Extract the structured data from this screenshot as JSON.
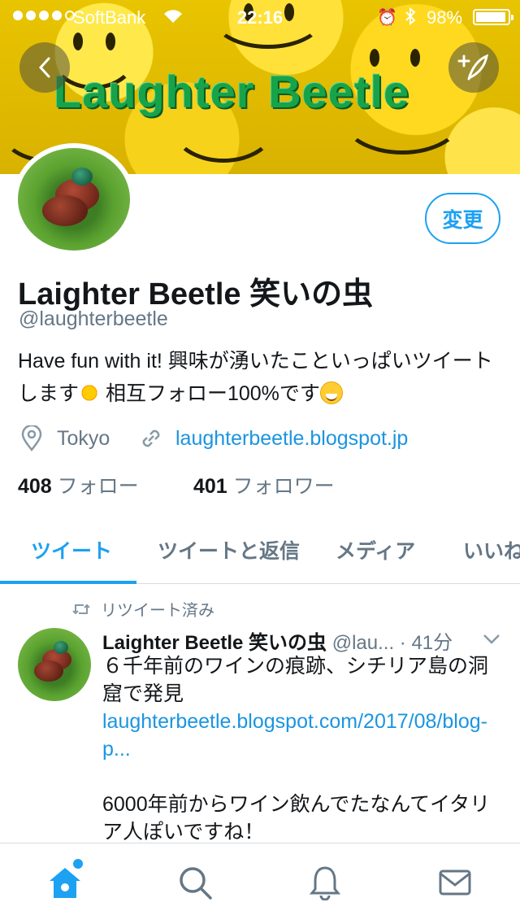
{
  "status_bar": {
    "carrier": "SoftBank",
    "time": "22:16",
    "battery": "98%"
  },
  "header": {
    "banner_text": "Laughter Beetle"
  },
  "profile": {
    "name": "Laighter Beetle 笑いの虫",
    "handle": "@laughterbeetle",
    "bio_part1": "Have fun with it! 興味が湧いたこといっぱいツイートします",
    "bio_part2": " 相互フォロー100%です",
    "location": "Tokyo",
    "website": "laughterbeetle.blogspot.jp",
    "following_count": "408",
    "following_label": "フォロー",
    "followers_count": "401",
    "followers_label": "フォロワー",
    "edit_label": "変更"
  },
  "tabs": [
    {
      "label": "ツイート",
      "active": true
    },
    {
      "label": "ツイートと返信",
      "active": false
    },
    {
      "label": "メディア",
      "active": false
    },
    {
      "label": "いいね",
      "active": false
    }
  ],
  "tweet": {
    "retweet_label": "リツイート済み",
    "name": "Laighter Beetle 笑いの虫",
    "handle": "@lau...",
    "time": " · 41分",
    "text1": "６千年前のワインの痕跡、シチリア島の洞窟で発見",
    "link": "laughterbeetle.blogspot.com/2017/08/blog-p...",
    "text2": "6000年前からワイン飲んでたなんてイタリア人ぽいですね！"
  },
  "colors": {
    "accent": "#1da1f2",
    "muted": "#657786",
    "link": "#1b95e0"
  },
  "icons": [
    "back-arrow-icon",
    "compose-icon",
    "location-icon",
    "link-icon",
    "retweet-icon",
    "chevron-down-icon",
    "home-icon",
    "search-icon",
    "bell-icon",
    "mail-icon"
  ]
}
